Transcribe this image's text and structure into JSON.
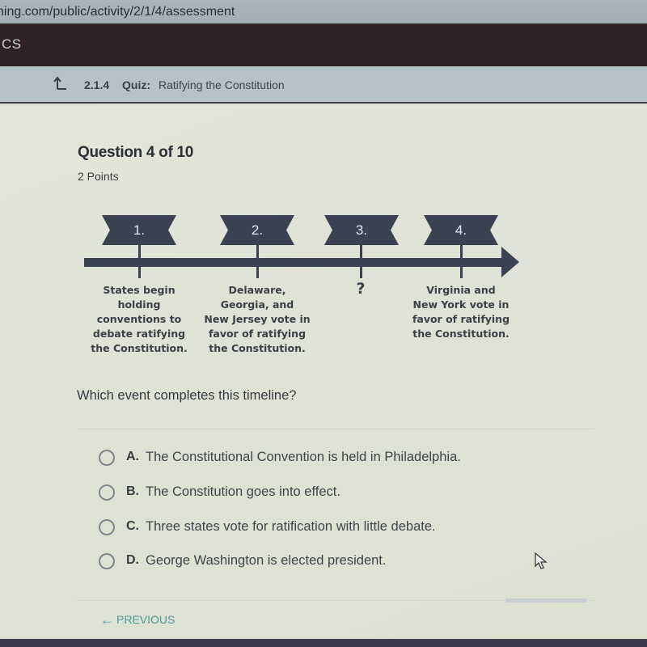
{
  "browser": {
    "url_visible": "ning.com/public/activity/2/1/4/assessment"
  },
  "topnav": {
    "label": "CS"
  },
  "breadcrumb": {
    "icon": "up-arrow-icon",
    "code": "2.1.4",
    "kind": "Quiz:",
    "title": "Ratifying the Constitution"
  },
  "question": {
    "title": "Question 4 of 10",
    "points": "2 Points",
    "prompt": "Which event completes this timeline?"
  },
  "timeline": {
    "color": "#3b4150",
    "events": [
      {
        "number": "1.",
        "text_lines": [
          "States begin",
          "holding",
          "conventions to",
          "debate ratifying",
          "the Constitution."
        ]
      },
      {
        "number": "2.",
        "text_lines": [
          "Delaware,",
          "Georgia, and",
          "New Jersey vote in",
          "favor of ratifying",
          "the Constitution."
        ]
      },
      {
        "number": "3.",
        "text_lines": [
          "?"
        ]
      },
      {
        "number": "4.",
        "text_lines": [
          "Virginia and",
          "New York vote in",
          "favor of ratifying",
          "the Constitution."
        ]
      }
    ]
  },
  "options": [
    {
      "letter": "A.",
      "text": "The Constitutional Convention is held in Philadelphia."
    },
    {
      "letter": "B.",
      "text": "The Constitution goes into effect."
    },
    {
      "letter": "C.",
      "text": "Three states vote for ratification with little debate."
    },
    {
      "letter": "D.",
      "text": "George Washington is elected president."
    }
  ],
  "navigation": {
    "previous_label": "PREVIOUS",
    "previous_icon": "left-arrow-icon",
    "accent_color": "#4a9a9c"
  }
}
